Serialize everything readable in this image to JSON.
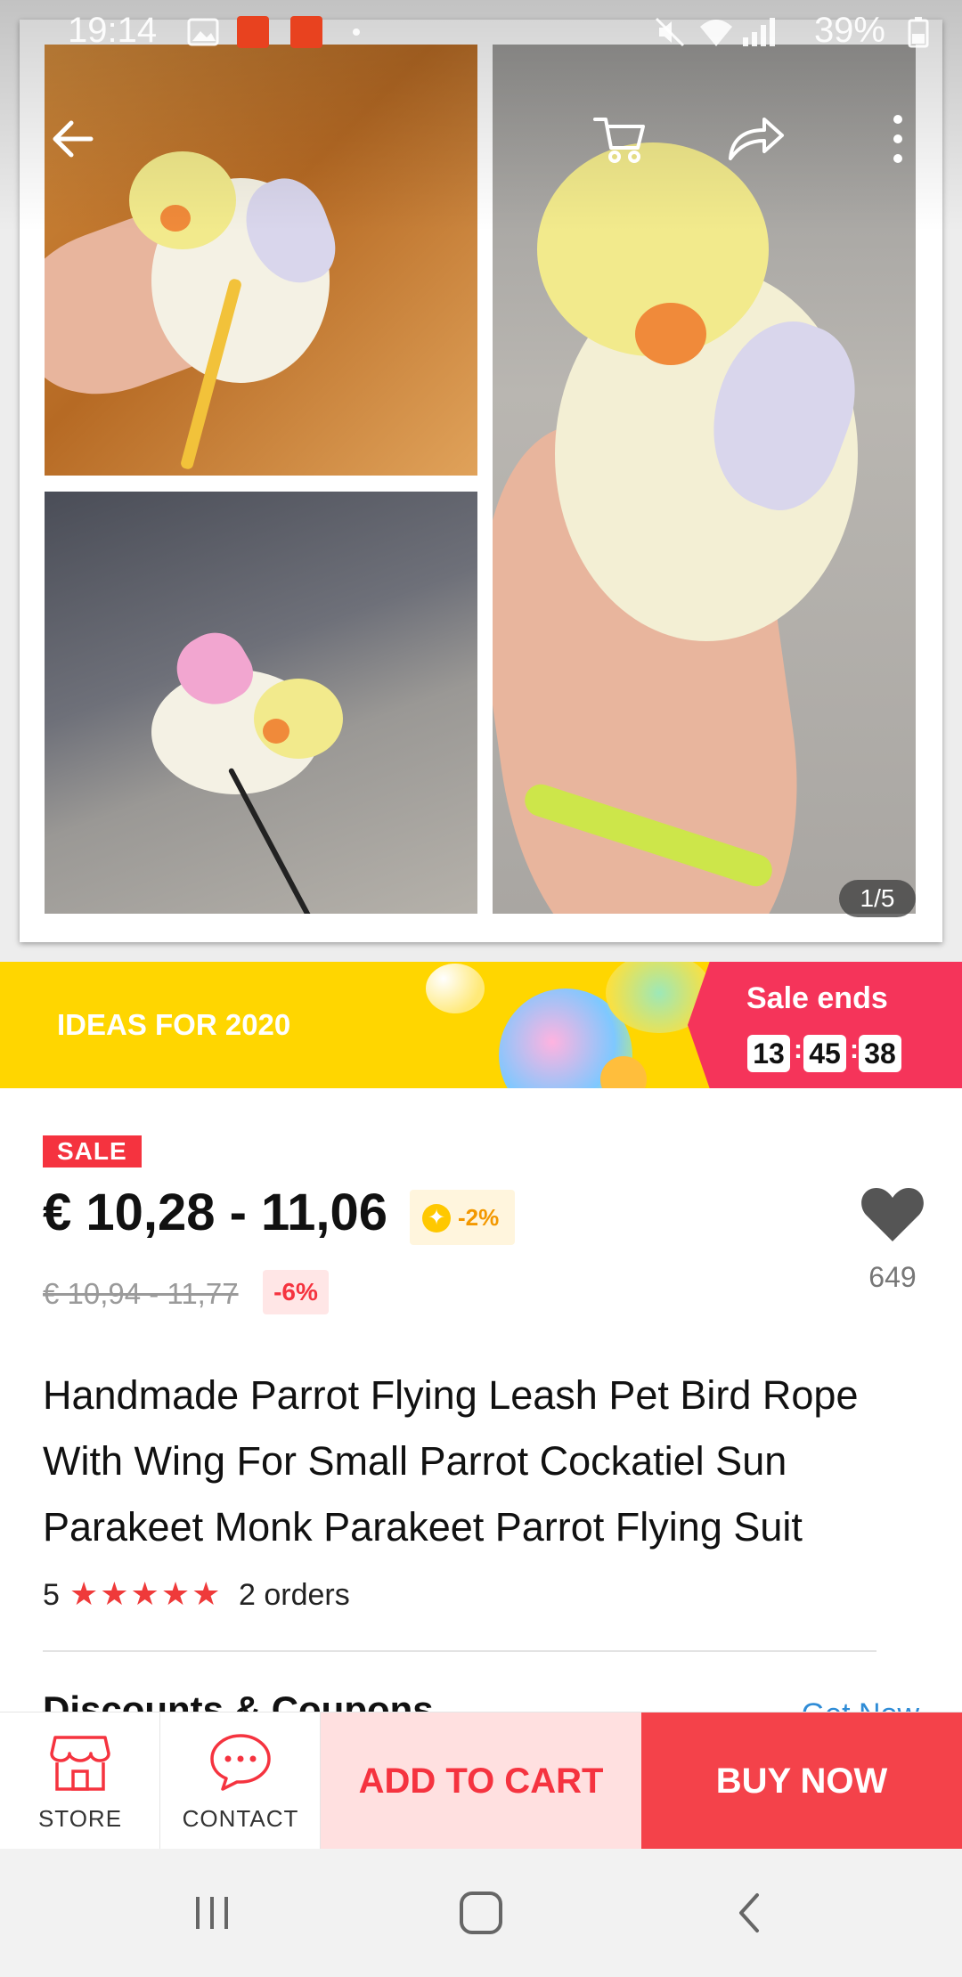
{
  "status_bar": {
    "time": "19:14",
    "battery": "39%",
    "icons": [
      "image-icon",
      "aliexpress-notification-icon",
      "aliexpress-notification-icon",
      "dot-icon",
      "mute-icon",
      "wifi-icon",
      "signal-icon",
      "battery-icon"
    ]
  },
  "toolbar": {
    "back_icon": "arrow-left-icon",
    "cart_icon": "cart-icon",
    "share_icon": "share-arrow-icon",
    "menu_icon": "more-vertical-icon"
  },
  "gallery": {
    "counter": "1/5"
  },
  "promo": {
    "title": "IDEAS FOR 2020",
    "sale_label": "Sale ends",
    "timer": {
      "hours": "13",
      "minutes": "45",
      "seconds": "38",
      "separator": ":"
    }
  },
  "product": {
    "sale_badge": "SALE",
    "price": "€ 10,28 - 11,06",
    "coin_discount": "-2%",
    "original_price": "€ 10,94 - 11,77",
    "discount": "-6%",
    "wishlist_count": "649",
    "title": "Handmade Parrot Flying Leash Pet Bird Rope With Wing For Small Parrot Cockatiel Sun Parakeet Monk Parakeet Parrot Flying Suit",
    "rating": "5",
    "stars": "★★★★★",
    "orders": "2 orders"
  },
  "coupons": {
    "title": "Discounts & Coupons",
    "link": "Get Now"
  },
  "actions": {
    "store": "STORE",
    "contact": "CONTACT",
    "add_to_cart": "ADD TO CART",
    "buy_now": "BUY NOW"
  },
  "colors": {
    "accent_red": "#f5333f",
    "buy_now_bg": "#f4424a",
    "add_cart_bg": "#ffe0e0",
    "promo_yellow": "#ffd600",
    "promo_pink": "#f5345a",
    "link_blue": "#2f8cd6"
  }
}
